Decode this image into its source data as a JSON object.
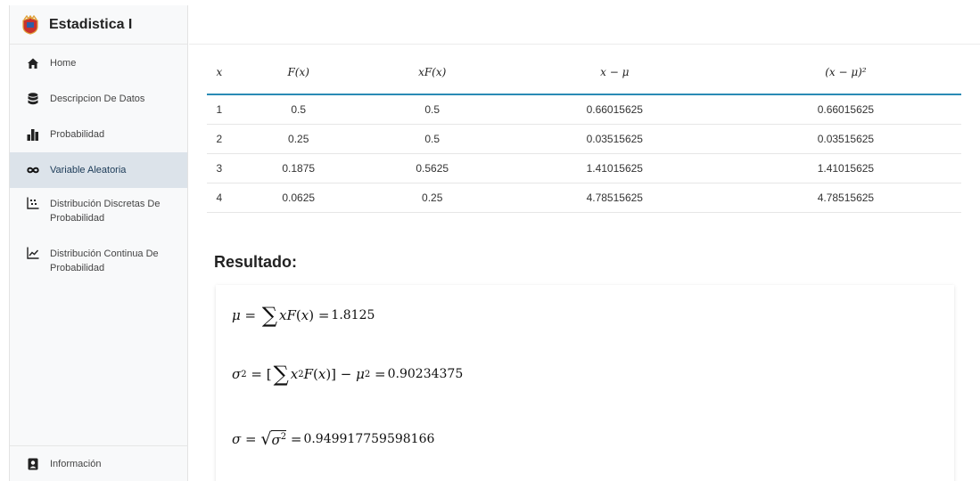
{
  "sidebar": {
    "title": "Estadistica I",
    "items": [
      {
        "label": "Home",
        "icon": "home-icon"
      },
      {
        "label": "Descripcion De Datos",
        "icon": "database-icon"
      },
      {
        "label": "Probabilidad",
        "icon": "bar-chart-icon"
      },
      {
        "label": "Variable Aleatoria",
        "icon": "infinity-icon",
        "active": true
      },
      {
        "label": "Distribución Discretas De Probabilidad",
        "icon": "scatter-icon"
      },
      {
        "label": "Distribución Continua De Probabilidad",
        "icon": "line-chart-icon"
      }
    ],
    "footer": {
      "label": "Información",
      "icon": "contact-icon"
    }
  },
  "table": {
    "headers": [
      "x",
      "F(x)",
      "xF(x)",
      "x − μ",
      "(x − μ)²"
    ],
    "rows": [
      [
        "1",
        "0.5",
        "0.5",
        "0.66015625",
        "0.66015625"
      ],
      [
        "2",
        "0.25",
        "0.5",
        "0.03515625",
        "0.03515625"
      ],
      [
        "3",
        "0.1875",
        "0.5625",
        "1.41015625",
        "1.41015625"
      ],
      [
        "4",
        "0.0625",
        "0.25",
        "4.78515625",
        "4.78515625"
      ]
    ]
  },
  "result": {
    "title": "Resultado:",
    "mean": "1.8125",
    "variance": "0.90234375",
    "std": "0.949917759598166"
  },
  "colors": {
    "accent": "#2a8bb5",
    "active_bg": "#dce3ea"
  }
}
